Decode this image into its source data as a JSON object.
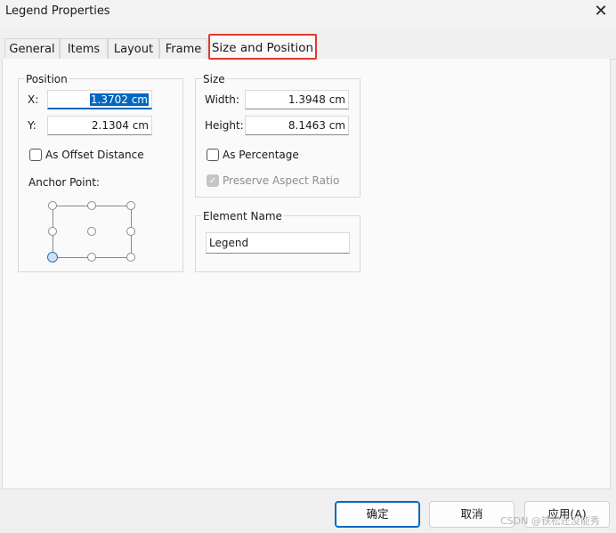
{
  "window": {
    "title": "Legend Properties"
  },
  "tabs": [
    "General",
    "Items",
    "Layout",
    "Frame",
    "Size and Position"
  ],
  "position": {
    "group_label": "Position",
    "x_label": "X:",
    "x_value": "1.3702 cm",
    "y_label": "Y:",
    "y_value": "2.1304 cm",
    "offset_label": "As Offset Distance",
    "anchor_label": "Anchor Point:"
  },
  "size": {
    "group_label": "Size",
    "width_label": "Width:",
    "width_value": "1.3948 cm",
    "height_label": "Height:",
    "height_value": "8.1463 cm",
    "percentage_label": "As Percentage",
    "aspect_label": "Preserve Aspect Ratio"
  },
  "element_name": {
    "group_label": "Element Name",
    "value": "Legend"
  },
  "buttons": {
    "ok": "确定",
    "cancel": "取消",
    "apply": "应用(A)"
  },
  "watermark": "CSDN @铁松还没能秀",
  "colors": {
    "accent": "#0067c0",
    "tab_highlight": "#e0382e"
  }
}
